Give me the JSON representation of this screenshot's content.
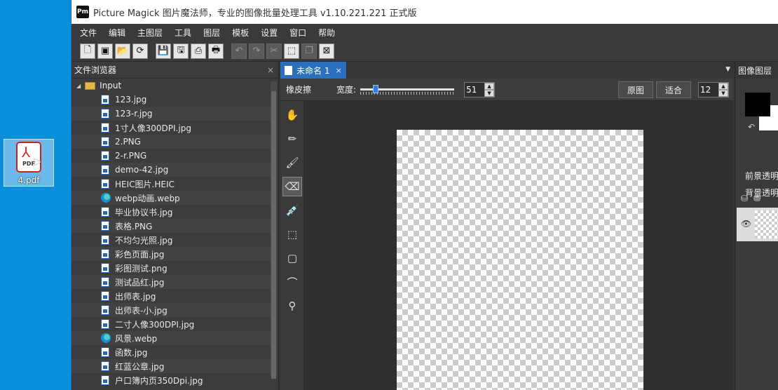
{
  "desktop": {
    "file_name": "4.pdf",
    "file_type_tag": "PDF"
  },
  "window": {
    "app_icon_text": "Pm",
    "title": "Picture Magick 图片魔法师，专业的图像批量处理工具 v1.10.221.221 正式版"
  },
  "menu": [
    "文件",
    "编辑",
    "主图层",
    "工具",
    "图层",
    "模板",
    "设置",
    "窗口",
    "帮助"
  ],
  "toolbar": {
    "buttons": [
      {
        "name": "new-file-icon",
        "glyph": "🗋",
        "enabled": true
      },
      {
        "name": "open-image-icon",
        "glyph": "▣",
        "enabled": true
      },
      {
        "name": "open-folder-icon",
        "glyph": "📂",
        "enabled": true
      },
      {
        "name": "refresh-icon",
        "glyph": "⟳",
        "enabled": true
      },
      {
        "name": "save-icon",
        "glyph": "💾",
        "enabled": true
      },
      {
        "name": "save-as-icon",
        "glyph": "🖫",
        "enabled": true
      },
      {
        "name": "print-icon",
        "glyph": "⎙",
        "enabled": true
      },
      {
        "name": "batch-print-icon",
        "glyph": "🖶",
        "enabled": true
      },
      {
        "name": "undo-icon",
        "glyph": "↶",
        "enabled": false
      },
      {
        "name": "redo-icon",
        "glyph": "↷",
        "enabled": false
      },
      {
        "name": "cut-icon",
        "glyph": "✂",
        "enabled": false
      },
      {
        "name": "crop-icon",
        "glyph": "⬚",
        "enabled": true
      },
      {
        "name": "copy-icon",
        "glyph": "❐",
        "enabled": false
      },
      {
        "name": "close-doc-icon",
        "glyph": "⊠",
        "enabled": true
      }
    ]
  },
  "file_browser": {
    "title": "文件浏览器",
    "close": "×",
    "root": "Input",
    "files": [
      {
        "name": "123.jpg",
        "type": "image"
      },
      {
        "name": "123-r.jpg",
        "type": "image"
      },
      {
        "name": "1寸人像300DPI.jpg",
        "type": "image"
      },
      {
        "name": "2.PNG",
        "type": "image"
      },
      {
        "name": "2-r.PNG",
        "type": "image"
      },
      {
        "name": "demo-42.jpg",
        "type": "image"
      },
      {
        "name": "HEIC图片.HEIC",
        "type": "image"
      },
      {
        "name": "webp动画.webp",
        "type": "webp"
      },
      {
        "name": "毕业协议书.jpg",
        "type": "image"
      },
      {
        "name": "表格.PNG",
        "type": "image"
      },
      {
        "name": "不均匀光照.jpg",
        "type": "image"
      },
      {
        "name": "彩色页面.jpg",
        "type": "image"
      },
      {
        "name": "彩图测试.png",
        "type": "image"
      },
      {
        "name": "测试品红.jpg",
        "type": "image"
      },
      {
        "name": "出师表.jpg",
        "type": "image"
      },
      {
        "name": "出师表-小.jpg",
        "type": "image"
      },
      {
        "name": "二寸人像300DPI.jpg",
        "type": "image"
      },
      {
        "name": "风景.webp",
        "type": "webp"
      },
      {
        "name": "函数.jpg",
        "type": "image"
      },
      {
        "name": "红蓝公章.jpg",
        "type": "image"
      },
      {
        "name": "户口簿内页350Dpi.jpg",
        "type": "image"
      }
    ]
  },
  "document": {
    "tab_label": "未命名 1",
    "tab_close": "×",
    "dropdown": "▼"
  },
  "tool_options": {
    "tool_name": "橡皮擦",
    "width_label": "宽度:",
    "width_value": "51",
    "width_fraction": 0.14,
    "original_button": "原图",
    "fit_button": "适合",
    "zoom_value": "12"
  },
  "tools": [
    {
      "name": "pan-hand-icon",
      "glyph": "✋",
      "active": false
    },
    {
      "name": "pencil-icon",
      "glyph": "✏",
      "active": false
    },
    {
      "name": "brush-icon",
      "glyph": "🖌",
      "active": false
    },
    {
      "name": "eraser-icon",
      "glyph": "⌫",
      "active": true
    },
    {
      "name": "eyedropper-icon",
      "glyph": "💉",
      "active": false
    },
    {
      "name": "magic-select-icon",
      "glyph": "⬚",
      "active": false
    },
    {
      "name": "rect-select-icon",
      "glyph": "▢",
      "active": false
    },
    {
      "name": "lasso-icon",
      "glyph": "⌒",
      "active": false
    },
    {
      "name": "stamp-icon",
      "glyph": "⚲",
      "active": false
    }
  ],
  "layers_panel": {
    "title": "图像图层",
    "fg_label": "前景透明",
    "bg_label": "背景透明",
    "swap_glyph": "↶",
    "eye_glyph": "👁",
    "fg_color": "#000000",
    "bg_color": "#ffffff"
  },
  "colors": {
    "accent": "#2b6fbf",
    "desktop": "#0a8fdc",
    "panel": "#3c3c3c"
  }
}
